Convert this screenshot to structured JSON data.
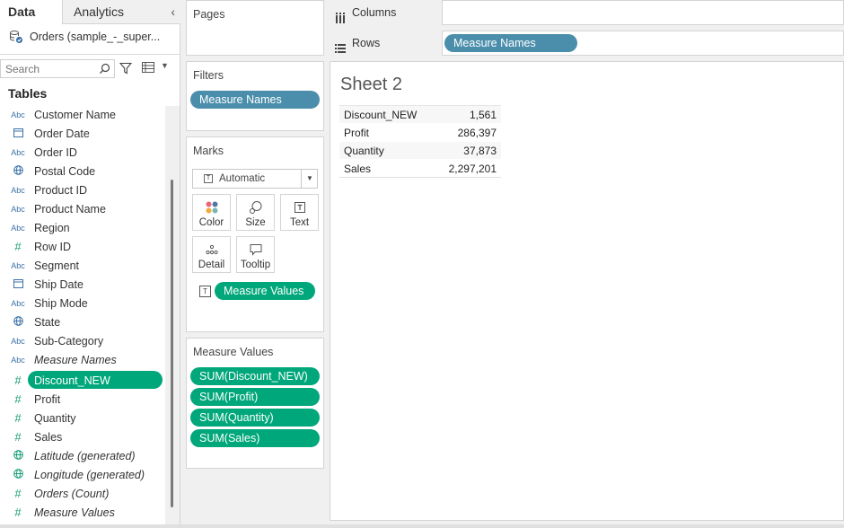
{
  "data_pane": {
    "tabs": {
      "data": "Data",
      "analytics": "Analytics"
    },
    "collapse_icon": "chevron-left-icon",
    "datasource": "Orders (sample_-_super...",
    "search": {
      "placeholder": "Search",
      "value": ""
    },
    "tables_heading": "Tables",
    "fields": [
      {
        "icon": "Abc",
        "type": "dimension",
        "label": "Customer Name"
      },
      {
        "icon": "calendar",
        "type": "dimension",
        "label": "Order Date"
      },
      {
        "icon": "Abc",
        "type": "dimension",
        "label": "Order ID"
      },
      {
        "icon": "globe",
        "type": "dimension",
        "label": "Postal Code"
      },
      {
        "icon": "Abc",
        "type": "dimension",
        "label": "Product ID"
      },
      {
        "icon": "Abc",
        "type": "dimension",
        "label": "Product Name"
      },
      {
        "icon": "Abc",
        "type": "dimension",
        "label": "Region"
      },
      {
        "icon": "#",
        "type": "dimension",
        "label": "Row ID"
      },
      {
        "icon": "Abc",
        "type": "dimension",
        "label": "Segment"
      },
      {
        "icon": "calendar",
        "type": "dimension",
        "label": "Ship Date"
      },
      {
        "icon": "Abc",
        "type": "dimension",
        "label": "Ship Mode"
      },
      {
        "icon": "globe",
        "type": "dimension",
        "label": "State"
      },
      {
        "icon": "Abc",
        "type": "dimension",
        "label": "Sub-Category"
      },
      {
        "icon": "Abc",
        "type": "dimension",
        "label": "Measure Names",
        "italic": true
      },
      {
        "icon": "#",
        "type": "measure",
        "label": "Discount_NEW",
        "selected": true
      },
      {
        "icon": "#",
        "type": "measure",
        "label": "Profit"
      },
      {
        "icon": "#",
        "type": "measure",
        "label": "Quantity"
      },
      {
        "icon": "#",
        "type": "measure",
        "label": "Sales"
      },
      {
        "icon": "globe",
        "type": "measure",
        "label": "Latitude (generated)",
        "italic": true
      },
      {
        "icon": "globe",
        "type": "measure",
        "label": "Longitude (generated)",
        "italic": true
      },
      {
        "icon": "#",
        "type": "measure",
        "label": "Orders (Count)",
        "italic": true
      },
      {
        "icon": "#",
        "type": "measure",
        "label": "Measure Values",
        "italic": true
      }
    ]
  },
  "shelves": {
    "pages": {
      "title": "Pages"
    },
    "filters": {
      "title": "Filters",
      "pill": "Measure Names"
    },
    "marks": {
      "title": "Marks",
      "mark_type": "Automatic",
      "buttons": {
        "color": "Color",
        "size": "Size",
        "text": "Text",
        "detail": "Detail",
        "tooltip": "Tooltip"
      },
      "text_pill": "Measure Values"
    },
    "measure_values": {
      "title": "Measure Values",
      "pills": [
        "SUM(Discount_NEW)",
        "SUM(Profit)",
        "SUM(Quantity)",
        "SUM(Sales)"
      ]
    },
    "columns": {
      "label": "Columns"
    },
    "rows": {
      "label": "Rows",
      "pill": "Measure Names"
    }
  },
  "view": {
    "sheet_title": "Sheet 2",
    "rows": [
      {
        "name": "Discount_NEW",
        "value": "1,561"
      },
      {
        "name": "Profit",
        "value": "286,397"
      },
      {
        "name": "Quantity",
        "value": "37,873"
      },
      {
        "name": "Sales",
        "value": "2,297,201"
      }
    ]
  },
  "colors": {
    "dimension_pill": "#4b8eac",
    "measure_pill": "#00a77a",
    "dimension_icon": "#3c72a8",
    "measure_icon": "#1b9e77"
  }
}
